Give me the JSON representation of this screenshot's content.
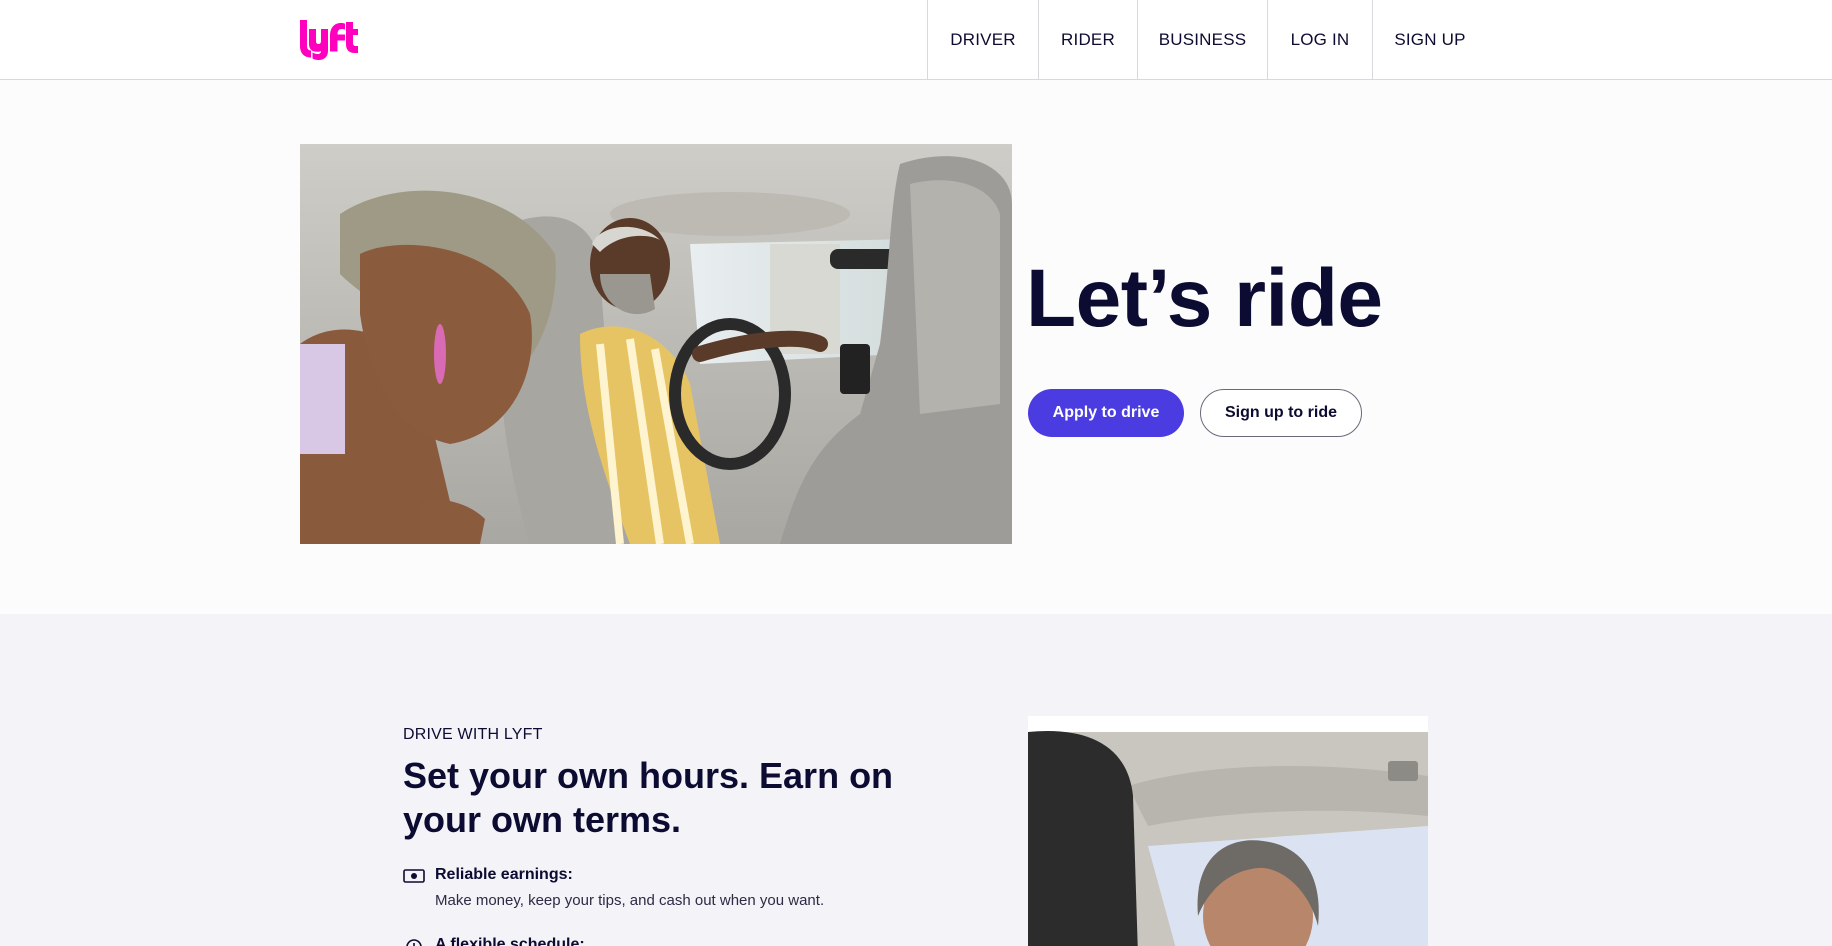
{
  "brand": {
    "name": "lyft",
    "color": "#ff00bf"
  },
  "nav": {
    "items": [
      {
        "label": "DRIVER"
      },
      {
        "label": "RIDER"
      },
      {
        "label": "BUSINESS"
      },
      {
        "label": "LOG IN"
      },
      {
        "label": "SIGN UP"
      }
    ]
  },
  "hero": {
    "title": "Let’s ride",
    "image_alt": "Passenger laughing in back seat while driver smiles at the wheel",
    "primary_button": "Apply to drive",
    "secondary_button": "Sign up to ride"
  },
  "drive": {
    "eyebrow": "DRIVE WITH LYFT",
    "title": "Set your own hours. Earn on your own terms.",
    "features": [
      {
        "icon": "cash-icon",
        "title": "Reliable earnings:",
        "desc": "Make money, keep your tips, and cash out when you want."
      },
      {
        "icon": "clock-icon",
        "title": "A flexible schedule:",
        "desc": ""
      }
    ],
    "image_alt": "Smiling driver seen from back seat"
  },
  "colors": {
    "accent": "#4a3ce0",
    "ink": "#0c0b31",
    "section_bg": "#f3f3f8"
  }
}
